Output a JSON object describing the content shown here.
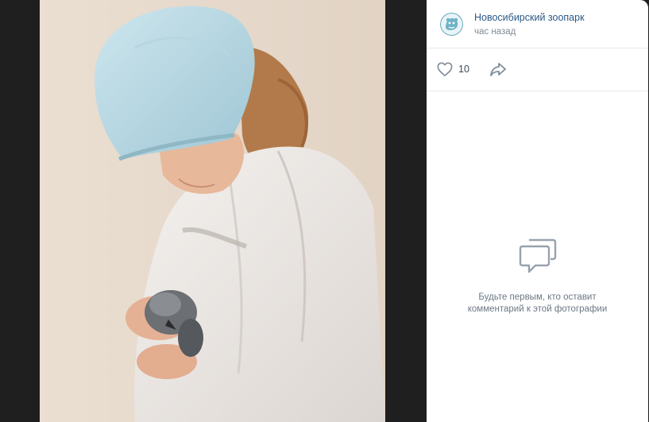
{
  "author": {
    "name": "Новосибирский зоопарк",
    "time": "час назад",
    "avatar_icon": "snow-leopard-logo-icon"
  },
  "actions": {
    "like_icon": "heart-outline-icon",
    "like_count": "10",
    "share_icon": "share-arrow-icon"
  },
  "comments": {
    "icon": "comments-bubble-icon",
    "empty_line1": "Будьте первым, кто оставит",
    "empty_line2": "комментарий к этой фотографии"
  },
  "photo": {
    "description_icon": "photo-zookeeper-holding-penguin-chick"
  },
  "colors": {
    "link": "#2a5885",
    "secondary": "#818c99",
    "divider": "#e7e8ec",
    "backdrop": "#1f1f1f",
    "icon_gray": "#99a2ad"
  }
}
